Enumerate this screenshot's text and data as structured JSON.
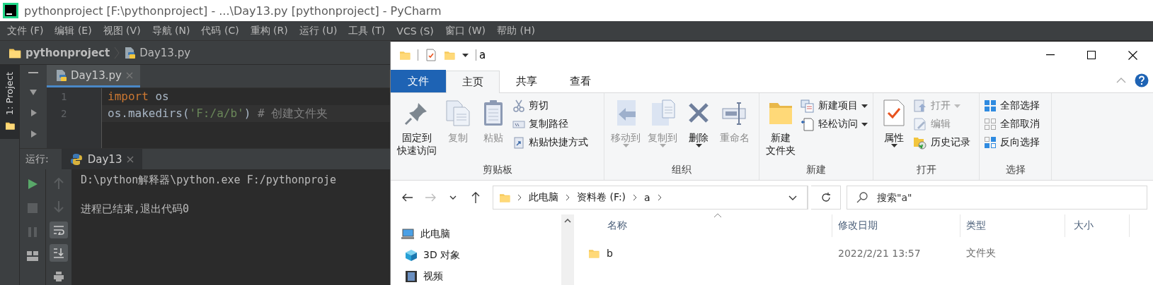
{
  "title_bar": {
    "title": "pythonproject [F:\\pythonproject] - ...\\Day13.py [pythonproject] - PyCharm"
  },
  "menu": [
    "文件 (F)",
    "编辑 (E)",
    "视图 (V)",
    "导航 (N)",
    "代码 (C)",
    "重构 (R)",
    "运行 (U)",
    "工具 (T)",
    "VCS (S)",
    "窗口 (W)",
    "帮助 (H)"
  ],
  "breadcrumb": [
    "pythonproject",
    "Day13.py"
  ],
  "tool_stripe": [
    {
      "label": "1: Project",
      "selected": true
    }
  ],
  "editor": {
    "tabs": [
      {
        "label": "Day13.py",
        "selected": true
      }
    ],
    "lines": [
      {
        "number": "1",
        "tokens": [
          {
            "kind": "keyword",
            "text": "import"
          },
          {
            "kind": "plain",
            "text": " os"
          }
        ]
      },
      {
        "number": "2",
        "tokens": [
          {
            "kind": "plain",
            "text": "os.makedirs("
          },
          {
            "kind": "string",
            "text": "'F:/a/b'"
          },
          {
            "kind": "plain",
            "text": ")"
          },
          {
            "kind": "comment",
            "text": " # 创建文件夹"
          }
        ]
      }
    ]
  },
  "run": {
    "label": "运行:",
    "tabs": [
      {
        "label": "Day13",
        "selected": true
      }
    ],
    "output": [
      "D:\\python解释器\\python.exe F:/pythonproje",
      "进程已结束,退出代码0"
    ]
  },
  "explorer": {
    "title": "a",
    "ribbon_tabs": [
      {
        "label": "文件",
        "kind": "file",
        "selected": false
      },
      {
        "label": "主页",
        "kind": "tab",
        "selected": true
      },
      {
        "label": "共享",
        "kind": "tab",
        "selected": false
      },
      {
        "label": "查看",
        "kind": "tab",
        "selected": false
      }
    ],
    "ribbon_groups": [
      {
        "label": "剪贴板",
        "items": [
          {
            "kind": "large",
            "lines": [
              "固定到",
              "快速访问"
            ],
            "dropdown": false,
            "disabled": false
          },
          {
            "kind": "large",
            "lines": [
              "复制"
            ],
            "dropdown": false,
            "disabled": true
          },
          {
            "kind": "large",
            "lines": [
              "粘贴"
            ],
            "dropdown": false,
            "disabled": true
          },
          {
            "kind": "stack",
            "buttons": [
              {
                "label": "剪切",
                "dropdown": false,
                "disabled": false
              },
              {
                "label": "复制路径",
                "dropdown": false,
                "disabled": false
              },
              {
                "label": "粘贴快捷方式",
                "dropdown": false,
                "disabled": false
              }
            ]
          }
        ]
      },
      {
        "label": "组织",
        "items": [
          {
            "kind": "large",
            "lines": [
              "移动到"
            ],
            "dropdown": true,
            "disabled": true
          },
          {
            "kind": "large",
            "lines": [
              "复制到"
            ],
            "dropdown": true,
            "disabled": true
          },
          {
            "kind": "large",
            "lines": [
              "删除"
            ],
            "dropdown": true,
            "disabled": false
          },
          {
            "kind": "large",
            "lines": [
              "重命名"
            ],
            "dropdown": false,
            "disabled": true
          }
        ]
      },
      {
        "label": "新建",
        "items": [
          {
            "kind": "large",
            "lines": [
              "新建",
              "文件夹"
            ],
            "dropdown": false,
            "disabled": false
          },
          {
            "kind": "stack",
            "buttons": [
              {
                "label": "新建项目",
                "dropdown": true,
                "disabled": false
              },
              {
                "label": "轻松访问",
                "dropdown": true,
                "disabled": false
              }
            ]
          }
        ]
      },
      {
        "label": "打开",
        "items": [
          {
            "kind": "large",
            "lines": [
              "属性"
            ],
            "dropdown": true,
            "disabled": false
          },
          {
            "kind": "stack",
            "buttons": [
              {
                "label": "打开",
                "dropdown": true,
                "disabled": true
              },
              {
                "label": "编辑",
                "dropdown": false,
                "disabled": true
              },
              {
                "label": "历史记录",
                "dropdown": false,
                "disabled": false
              }
            ]
          }
        ]
      },
      {
        "label": "选择",
        "items": [
          {
            "kind": "stack",
            "buttons": [
              {
                "label": "全部选择",
                "dropdown": false,
                "disabled": false
              },
              {
                "label": "全部取消",
                "dropdown": false,
                "disabled": false
              },
              {
                "label": "反向选择",
                "dropdown": false,
                "disabled": false
              }
            ]
          }
        ]
      }
    ],
    "address": [
      "此电脑",
      "资料卷 (F:)",
      "a"
    ],
    "search": {
      "placeholder": "搜索\"a\""
    },
    "nav": [
      "此电脑",
      "3D 对象",
      "视频"
    ],
    "columns": [
      "名称",
      "修改日期",
      "类型",
      "大小"
    ],
    "rows": [
      {
        "cells": [
          "b",
          "2022/2/21 13:57",
          "文件夹"
        ]
      }
    ]
  }
}
